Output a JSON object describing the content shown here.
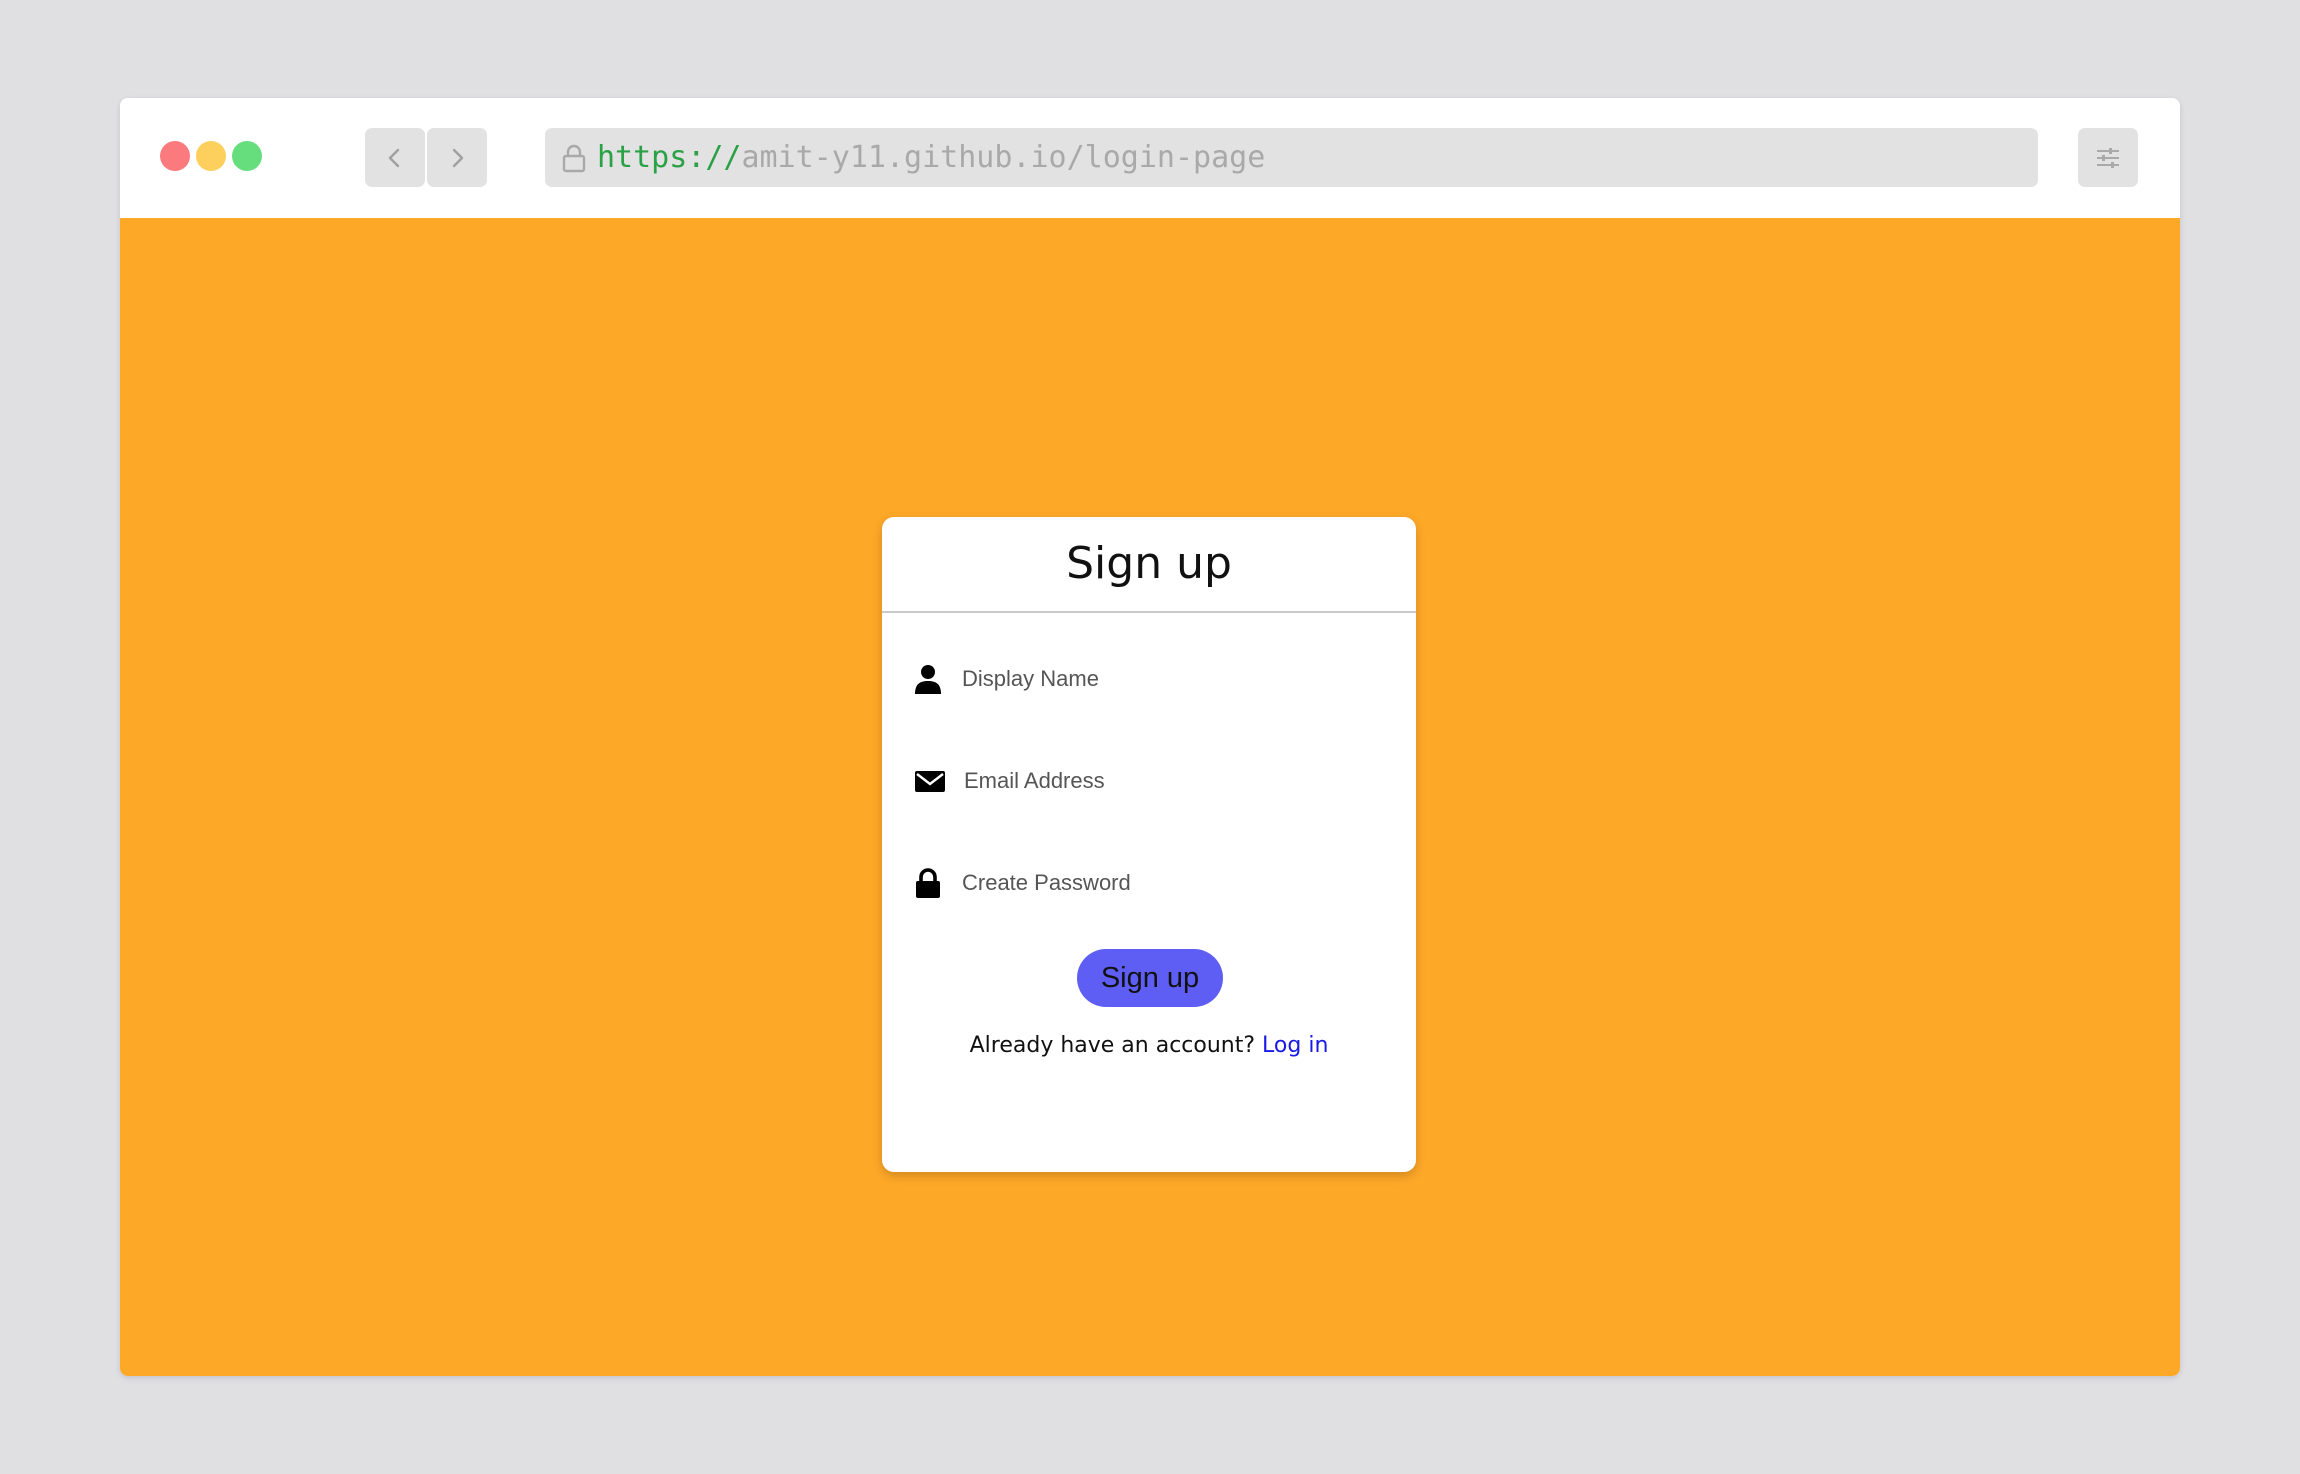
{
  "browser": {
    "url_protocol": "https://",
    "url_path": "amit-y11.github.io/login-page",
    "traffic_light_colors": [
      "#fb7a7e",
      "#fdcf5d",
      "#66de7e"
    ]
  },
  "icons": {
    "back": "chevron-left-icon",
    "forward": "chevron-right-icon",
    "lock": "lock-icon",
    "menu": "sliders-icon",
    "user": "user-icon",
    "email": "envelope-icon",
    "password": "lock-icon"
  },
  "colors": {
    "page_background": "#fea828",
    "button": "#5e5ef5",
    "link": "#1a1ae6"
  },
  "signup_form": {
    "title": "Sign up",
    "display_name_placeholder": "Display Name",
    "email_placeholder": "Email Address",
    "password_placeholder": "Create Password",
    "submit_label": "Sign up",
    "login_prompt": "Already have an account?",
    "login_link": "Log in"
  }
}
